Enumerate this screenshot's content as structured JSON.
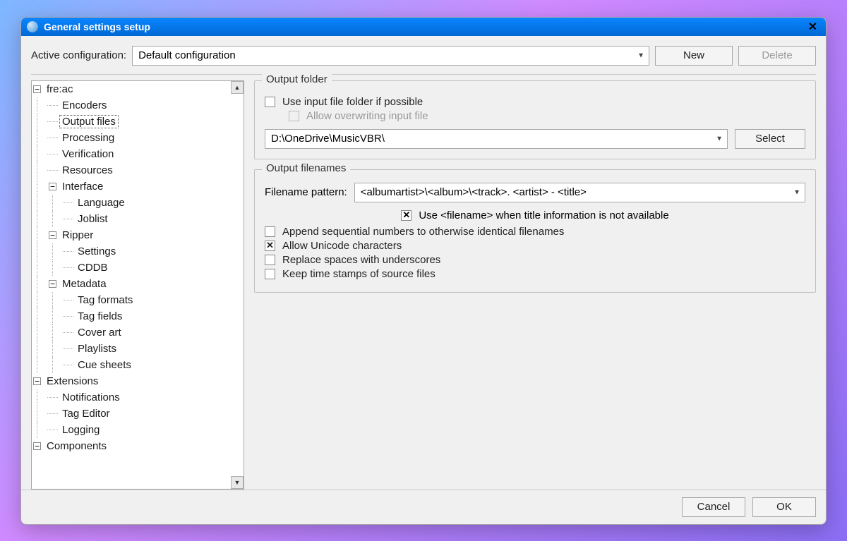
{
  "window": {
    "title": "General settings setup"
  },
  "config": {
    "label": "Active configuration:",
    "selected": "Default configuration",
    "new_btn": "New",
    "delete_btn": "Delete"
  },
  "tree": {
    "root": "fre:ac",
    "items": {
      "encoders": "Encoders",
      "output_files": "Output files",
      "processing": "Processing",
      "verification": "Verification",
      "resources": "Resources",
      "interface": "Interface",
      "language": "Language",
      "joblist": "Joblist",
      "ripper": "Ripper",
      "settings": "Settings",
      "cddb": "CDDB",
      "metadata": "Metadata",
      "tag_formats": "Tag formats",
      "tag_fields": "Tag fields",
      "cover_art": "Cover art",
      "playlists": "Playlists",
      "cue_sheets": "Cue sheets",
      "extensions": "Extensions",
      "notifications": "Notifications",
      "tag_editor": "Tag Editor",
      "logging": "Logging",
      "components": "Components"
    }
  },
  "output_folder": {
    "legend": "Output folder",
    "use_input_folder": "Use input file folder if possible",
    "allow_overwrite": "Allow overwriting input file",
    "path": "D:\\OneDrive\\MusicVBR\\",
    "select_btn": "Select"
  },
  "output_filenames": {
    "legend": "Output filenames",
    "pattern_label": "Filename pattern:",
    "pattern_value": "<albumartist>\\<album>\\<track>. <artist> - <title>",
    "use_filename_when_no_title": "Use <filename> when title information is not available",
    "append_sequential": "Append sequential numbers to otherwise identical filenames",
    "allow_unicode": "Allow Unicode characters",
    "replace_spaces": "Replace spaces with underscores",
    "keep_timestamps": "Keep time stamps of source files"
  },
  "footer": {
    "cancel": "Cancel",
    "ok": "OK"
  }
}
